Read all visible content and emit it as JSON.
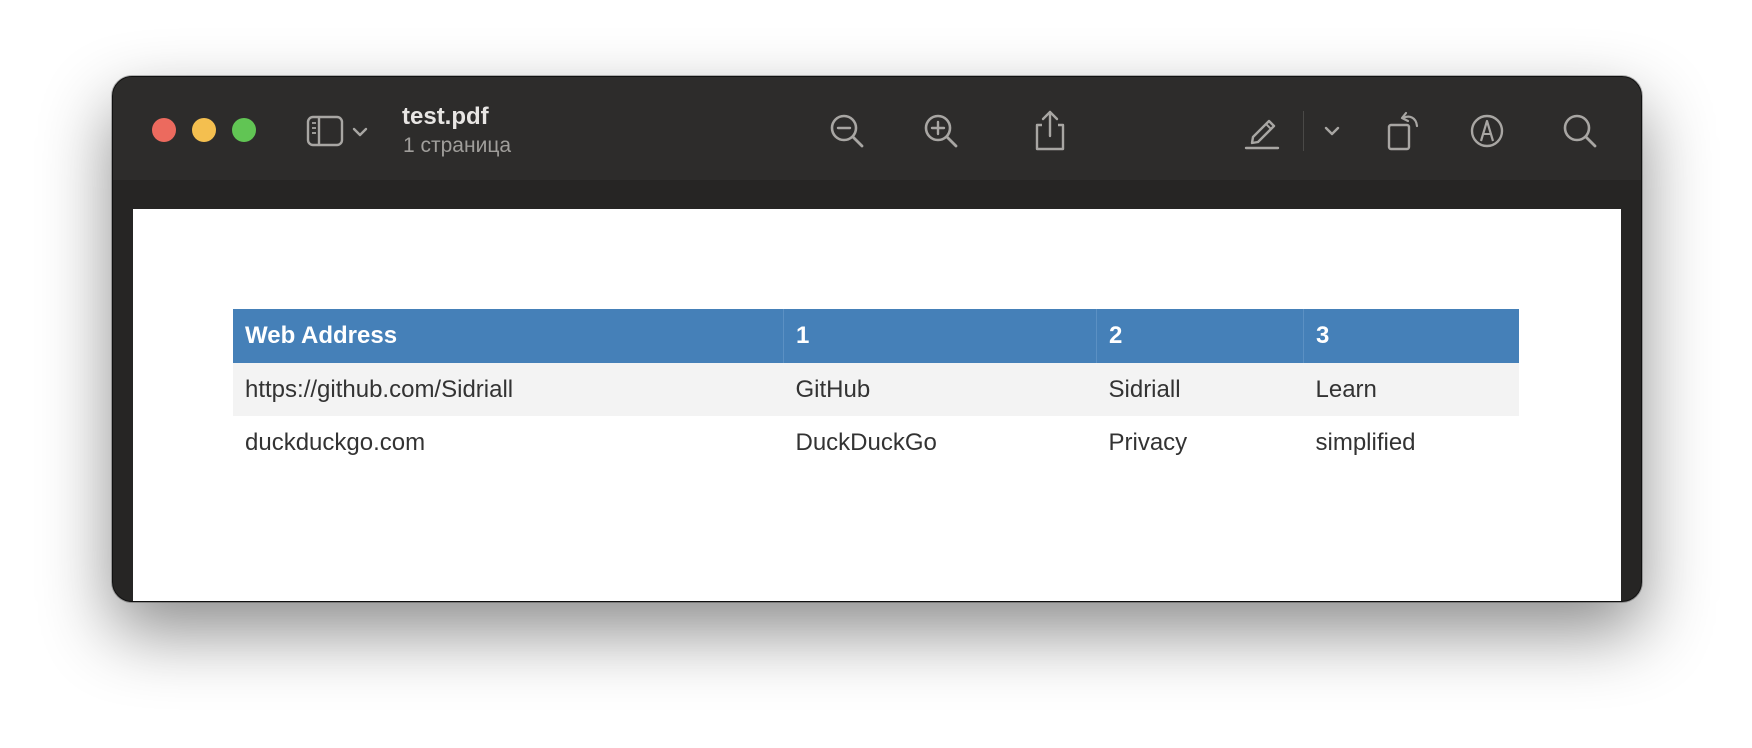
{
  "window": {
    "title": "test.pdf",
    "subtitle": "1 страница"
  },
  "toolbar": {
    "icons": [
      "sidebar-icon",
      "chevron-down-icon",
      "zoom-out-icon",
      "zoom-in-icon",
      "share-icon",
      "highlight-pen-icon",
      "chevron-down-icon",
      "rotate-icon",
      "markup-icon",
      "search-icon"
    ]
  },
  "colors": {
    "header_bg": "#4580b8",
    "row_alt_bg": "#f3f3f3",
    "titlebar_bg": "#2d2c2b"
  },
  "table": {
    "headers": [
      "Web Address",
      "1",
      "2",
      "3"
    ],
    "rows": [
      [
        "https://github.com/Sidriall",
        "GitHub",
        "Sidriall",
        "Learn"
      ],
      [
        "duckduckgo.com",
        "DuckDuckGo",
        "Privacy",
        "simplified"
      ]
    ]
  }
}
